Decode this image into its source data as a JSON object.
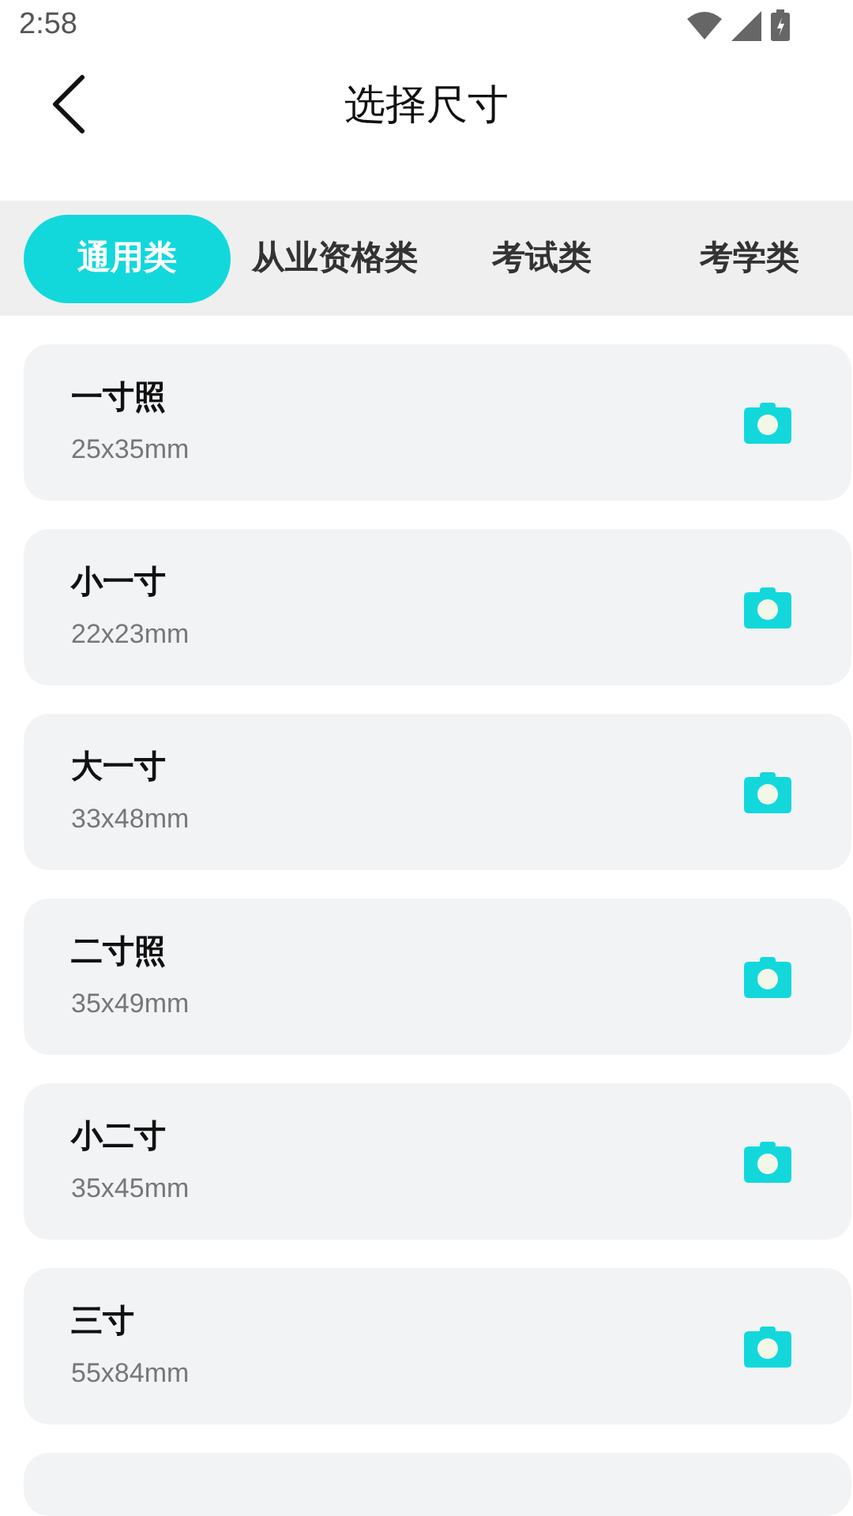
{
  "status_bar": {
    "time": "2:58"
  },
  "header": {
    "title": "选择尺寸"
  },
  "tabs": [
    {
      "label": "通用类",
      "selected": true
    },
    {
      "label": "从业资格类",
      "selected": false
    },
    {
      "label": "考试类",
      "selected": false
    },
    {
      "label": "考学类",
      "selected": false
    }
  ],
  "sizes": [
    {
      "name": "一寸照",
      "dimensions": "25x35mm"
    },
    {
      "name": "小一寸",
      "dimensions": "22x23mm"
    },
    {
      "name": "大一寸",
      "dimensions": "33x48mm"
    },
    {
      "name": "二寸照",
      "dimensions": "35x49mm"
    },
    {
      "name": "小二寸",
      "dimensions": "35x45mm"
    },
    {
      "name": "三寸",
      "dimensions": "55x84mm"
    }
  ]
}
